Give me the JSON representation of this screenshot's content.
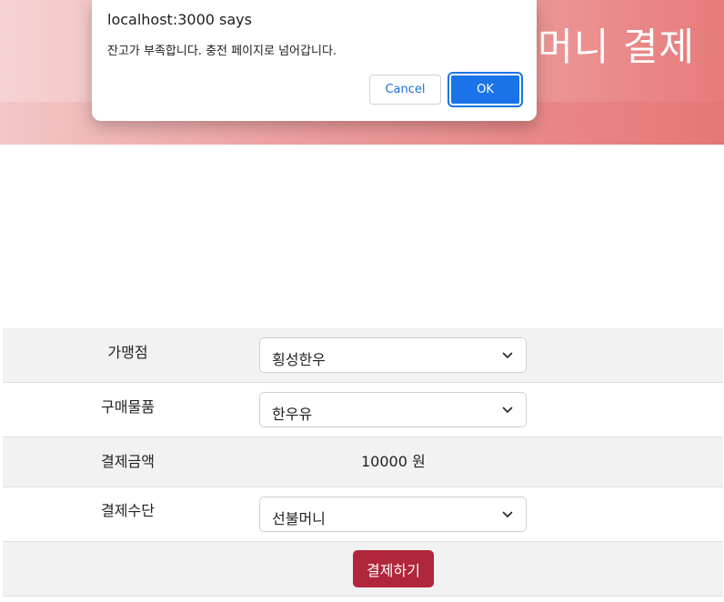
{
  "header": {
    "title": "머니 결제"
  },
  "dialog": {
    "origin": "localhost:3000 says",
    "message": "잔고가 부족합니다. 충전 페이지로 넘어갑니다.",
    "cancel_label": "Cancel",
    "ok_label": "OK"
  },
  "form": {
    "store": {
      "label": "가맹점",
      "value": "횡성한우"
    },
    "item": {
      "label": "구매물품",
      "value": "한우유"
    },
    "amount": {
      "label": "결제금액",
      "value": "10000 원"
    },
    "method": {
      "label": "결제수단",
      "value": "선불머니"
    },
    "submit_label": "결제하기"
  },
  "colors": {
    "banner": "#e98a8a",
    "pay_button": "#b0263b",
    "ok_button": "#1a73e8",
    "row_shade": "#f2f2f2"
  },
  "icons": {
    "dropdown": "chevron-down-icon"
  }
}
